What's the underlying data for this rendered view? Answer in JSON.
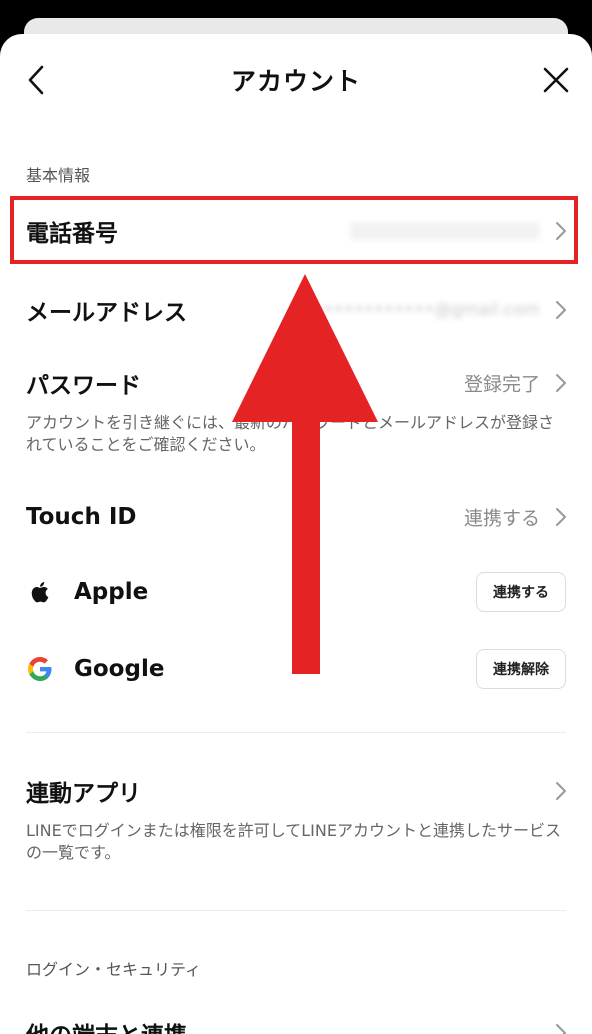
{
  "header": {
    "title": "アカウント",
    "back_icon": "chevron-left-icon",
    "close_icon": "close-icon"
  },
  "sections": {
    "basic_info_label": "基本情報",
    "login_security_label": "ログイン・セキュリティ"
  },
  "rows": {
    "phone": {
      "label": "電話番号",
      "value": ""
    },
    "email": {
      "label": "メールアドレス",
      "value": "••••••••••••@gmail.com"
    },
    "password": {
      "label": "パスワード",
      "value": "登録完了",
      "description": "アカウントを引き継ぐには、最新のパスワードとメールアドレスが登録されていることをご確認ください。"
    },
    "touch_id": {
      "label": "Touch ID",
      "value": "連携する"
    },
    "apple": {
      "label": "Apple",
      "button": "連携する",
      "icon": "apple-icon"
    },
    "google": {
      "label": "Google",
      "button": "連携解除",
      "icon": "google-icon"
    },
    "linked_apps": {
      "label": "連動アプリ",
      "description": "LINEでログインまたは権限を許可してLINEアカウントと連携したサービスの一覧です。"
    },
    "other_devices": {
      "label": "他の端末と連携"
    }
  },
  "colors": {
    "highlight": "#e52224",
    "arrow": "#e52224",
    "google_blue": "#4285F4",
    "google_red": "#EA4335",
    "google_yellow": "#FBBC05",
    "google_green": "#34A853"
  }
}
